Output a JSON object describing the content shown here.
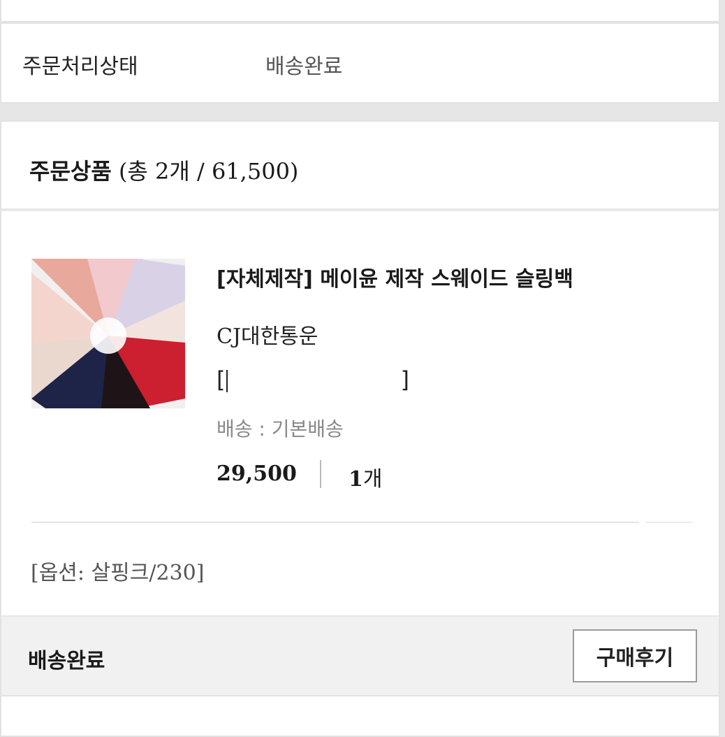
{
  "order_status": {
    "label": "주문처리상태",
    "value": "배송완료"
  },
  "order_items": {
    "title": "주문상품",
    "summary": "(총 2개 / 61,500)"
  },
  "product": {
    "name": "[자체제작] 메이윤 제작 스웨이드 슬링백",
    "courier": "CJ대한통운",
    "tracking_open": "[",
    "tracking_close": "]",
    "shipping_type": "배송 : 기본배송",
    "price": "29,500",
    "quantity_num": "1",
    "quantity_unit": "개",
    "option": "[옵션: 살핑크/230]",
    "thumbnail_colors": [
      "#e9a89c",
      "#f2c9cc",
      "#d9d1e6",
      "#f3e3de",
      "#cc1f2f",
      "#1e2447",
      "#1e1418",
      "#ead8cf",
      "#f4d5cd"
    ]
  },
  "footer": {
    "status": "배송완료",
    "review_button": "구매후기"
  }
}
